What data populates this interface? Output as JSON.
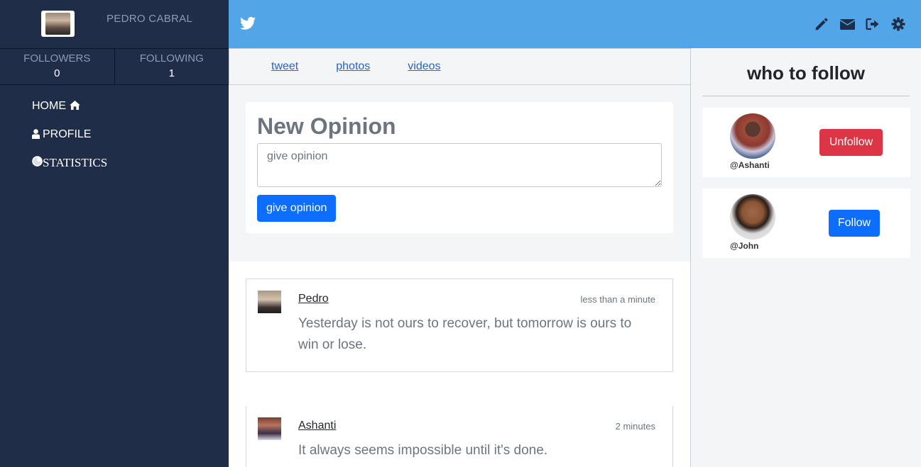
{
  "sidebar": {
    "profile_name": "PEDRO CABRAL",
    "followers_label": "FOLLOWERS",
    "followers_count": "0",
    "following_label": "FOLLOWING",
    "following_count": "1",
    "nav": [
      {
        "label": "HOME",
        "icon": "home-icon"
      },
      {
        "label": "PROFILE",
        "icon": "user-icon"
      },
      {
        "label": "STATISTICS",
        "icon": "pie-chart-icon"
      }
    ]
  },
  "topbar": {
    "brand_icon": "twitter-bird-icon",
    "icons": [
      "pencil-icon",
      "envelope-icon",
      "sign-out-icon",
      "gear-icon"
    ],
    "color": "#52a5e6"
  },
  "tabs": [
    "tweet",
    "photos",
    "videos"
  ],
  "composer": {
    "title": "New Opinion",
    "placeholder": "give opinion",
    "button": "give opinion"
  },
  "feed": [
    {
      "author": "Pedro",
      "time": "less than a minute",
      "text": "Yesterday is not ours to recover, but tomorrow is ours to win or lose."
    },
    {
      "author": "Ashanti",
      "time": "2 minutes",
      "text": "It always seems impossible until it's done."
    }
  ],
  "who_to_follow": {
    "title": "who to follow",
    "users": [
      {
        "handle": "@Ashanti",
        "button": "Unfollow"
      },
      {
        "handle": "@John",
        "button": "Follow"
      }
    ]
  }
}
